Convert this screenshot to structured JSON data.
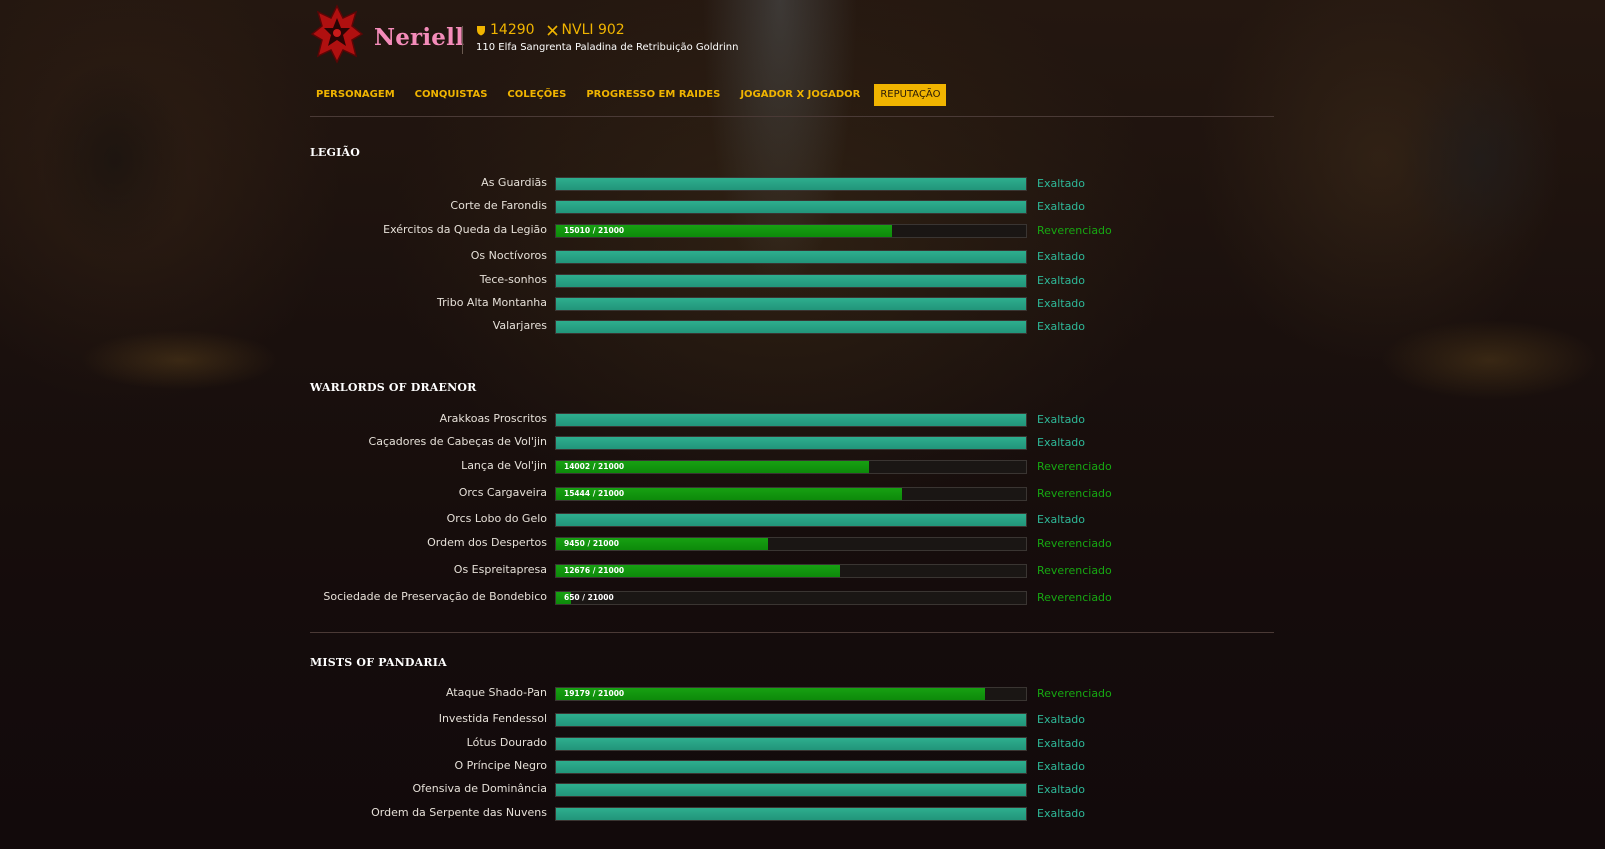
{
  "character": {
    "name": "Neriell",
    "achievement_points": "14290",
    "item_level": "NVLI 902",
    "description": "110 Elfa Sangrenta Paladina de Retribuição Goldrinn",
    "name_color": "#f48cba",
    "accent_color": "#f0b400"
  },
  "nav": {
    "tabs": [
      {
        "label": "PERSONAGEM",
        "active": false
      },
      {
        "label": "CONQUISTAS",
        "active": false
      },
      {
        "label": "COLEÇÕES",
        "active": false
      },
      {
        "label": "PROGRESSO EM RAIDES",
        "active": false
      },
      {
        "label": "JOGADOR X JOGADOR",
        "active": false
      },
      {
        "label": "REPUTAÇÃO",
        "active": true
      }
    ]
  },
  "status_colors": {
    "exalted": "#2eb898",
    "revered": "#17a812"
  },
  "sections": [
    {
      "title": "LEGIÃO",
      "factions": [
        {
          "name": "As Guardiãs",
          "status": "Exaltado",
          "progress": 1.0
        },
        {
          "name": "Corte de Farondis",
          "status": "Exaltado",
          "progress": 1.0
        },
        {
          "name": "Exércitos da Queda da Legião",
          "status": "Reverenciado",
          "value": "15010 / 21000",
          "progress": 0.7148
        },
        {
          "name": "Os Noctívoros",
          "status": "Exaltado",
          "progress": 1.0
        },
        {
          "name": "Tece-sonhos",
          "status": "Exaltado",
          "progress": 1.0
        },
        {
          "name": "Tribo Alta Montanha",
          "status": "Exaltado",
          "progress": 1.0
        },
        {
          "name": "Valarjares",
          "status": "Exaltado",
          "progress": 1.0
        }
      ]
    },
    {
      "title": "WARLORDS OF DRAENOR",
      "factions": [
        {
          "name": "Arakkoas Proscritos",
          "status": "Exaltado",
          "progress": 1.0
        },
        {
          "name": "Caçadores de Cabeças de Vol'jin",
          "status": "Exaltado",
          "progress": 1.0
        },
        {
          "name": "Lança de Vol'jin",
          "status": "Reverenciado",
          "value": "14002 / 21000",
          "progress": 0.6668
        },
        {
          "name": "Orcs Cargaveira",
          "status": "Reverenciado",
          "value": "15444 / 21000",
          "progress": 0.7354
        },
        {
          "name": "Orcs Lobo do Gelo",
          "status": "Exaltado",
          "progress": 1.0
        },
        {
          "name": "Ordem dos Despertos",
          "status": "Reverenciado",
          "value": "9450 / 21000",
          "progress": 0.45
        },
        {
          "name": "Os Espreitapresa",
          "status": "Reverenciado",
          "value": "12676 / 21000",
          "progress": 0.6036
        },
        {
          "name": "Sociedade de Preservação de Bondebico",
          "status": "Reverenciado",
          "value": "650 / 21000",
          "progress": 0.031
        }
      ]
    },
    {
      "title": "MISTS OF PANDARIA",
      "factions": [
        {
          "name": "Ataque Shado-Pan",
          "status": "Reverenciado",
          "value": "19179 / 21000",
          "progress": 0.9133
        },
        {
          "name": "Investida Fendessol",
          "status": "Exaltado",
          "progress": 1.0
        },
        {
          "name": "Lótus Dourado",
          "status": "Exaltado",
          "progress": 1.0
        },
        {
          "name": "O Príncipe Negro",
          "status": "Exaltado",
          "progress": 1.0
        },
        {
          "name": "Ofensiva de Dominância",
          "status": "Exaltado",
          "progress": 1.0
        },
        {
          "name": "Ordem da Serpente das Nuvens",
          "status": "Exaltado",
          "progress": 1.0
        }
      ]
    }
  ]
}
